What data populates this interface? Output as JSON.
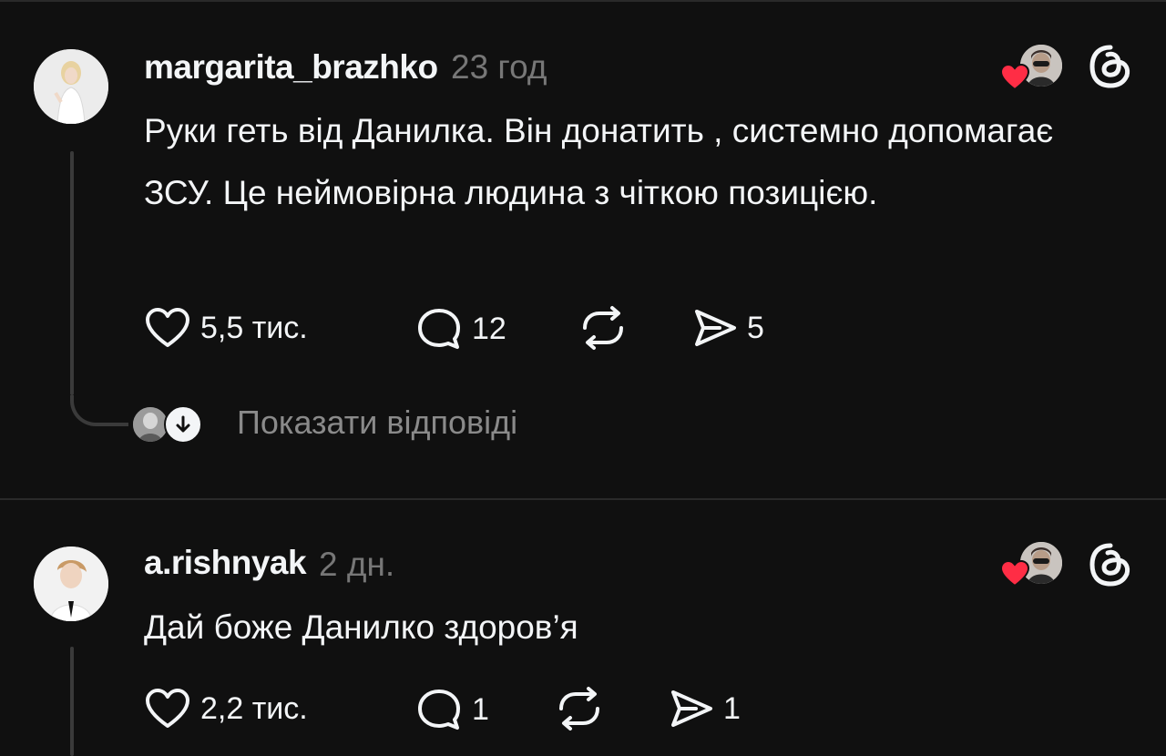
{
  "posts": [
    {
      "username": "margarita_brazhko",
      "timestamp": "23 год",
      "text": "Руки геть від Данилка. Він донатить , системно допомагає ЗСУ. Це неймовірна людина з чіткою позицією.",
      "likes": "5,5 тис.",
      "replies": "12",
      "shares": "5",
      "show_replies": "Показати відповіді"
    },
    {
      "username": "a.rishnyak",
      "timestamp": "2 дн.",
      "text": "Дай боже Данилко здоров’я",
      "likes": "2,2 тис.",
      "replies": "1",
      "shares": "1"
    }
  ],
  "colors": {
    "background": "#101010",
    "text": "#f3f5f7",
    "muted": "#777777",
    "heart": "#ff2d45"
  },
  "icons": [
    "heart-icon",
    "comment-icon",
    "repost-icon",
    "share-icon",
    "threads-logo-icon",
    "arrow-down-icon"
  ]
}
